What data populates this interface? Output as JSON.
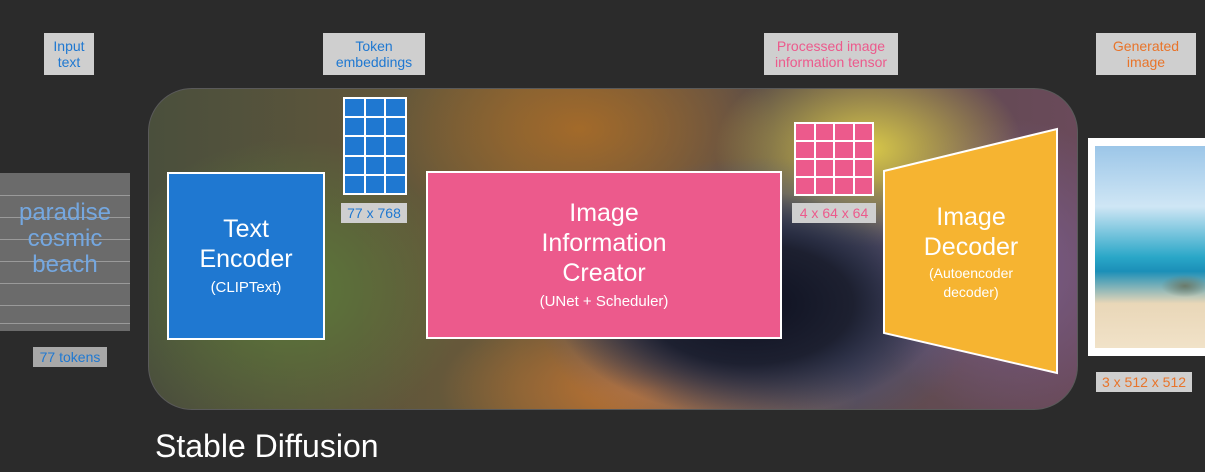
{
  "labels": {
    "input_text": "Input\ntext",
    "token_embeddings": "Token\nembeddings",
    "processed_tensor": "Processed image\ninformation tensor",
    "generated_image": "Generated\nimage"
  },
  "input": {
    "words": "paradise\ncosmic\nbeach",
    "tokens": "77 tokens"
  },
  "text_encoder": {
    "title": "Text\nEncoder",
    "subtitle": "(CLIPText)"
  },
  "embedding_dims": "77 x 768",
  "image_info_creator": {
    "title": "Image\nInformation\nCreator",
    "subtitle": "(UNet + Scheduler)"
  },
  "latent_dims": "4 x 64 x 64",
  "image_decoder": {
    "title": "Image\nDecoder",
    "subtitle": "(Autoencoder\ndecoder)"
  },
  "output_dims": "3 x 512 x 512",
  "caption": "Stable Diffusion",
  "colors": {
    "background": "#2b2b2b",
    "label_box": "#cfcfcf",
    "blue": "#1f78d1",
    "light_blue": "#74a7e0",
    "pink": "#ec5a8c",
    "orange": "#f6b431",
    "orange_text": "#e8742a"
  }
}
